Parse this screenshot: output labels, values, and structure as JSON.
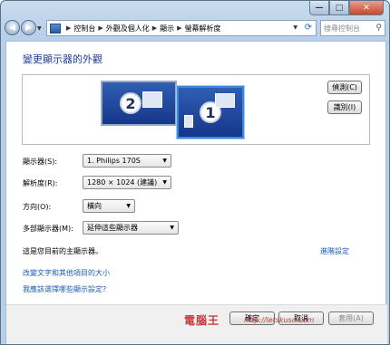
{
  "window": {
    "caption_min": "—",
    "caption_max": "□",
    "caption_close": "✕"
  },
  "nav": {
    "back_icon": "back-arrow-icon",
    "forward_icon": "forward-arrow-icon",
    "breadcrumbs": [
      "控制台",
      "外觀及個人化",
      "顯示",
      "螢幕解析度"
    ],
    "search_placeholder": "搜尋控制台"
  },
  "page": {
    "title": "變更顯示器的外觀",
    "detect_button": "偵測(C)",
    "identify_button": "識別(I)",
    "monitor_2_number": "2",
    "monitor_1_number": "1"
  },
  "settings": {
    "display_label": "顯示器(S):",
    "display_value": "1. Philips 170S",
    "resolution_label": "解析度(R):",
    "resolution_value": "1280 × 1024 (建議)",
    "orientation_label": "方向(O):",
    "orientation_value": "橫向",
    "multi_label": "多部顯示器(M):",
    "multi_value": "延伸這些顯示器"
  },
  "info": {
    "main_display_text": "這是您目前的主顯示器。",
    "advanced_link": "進階設定",
    "text_size_link": "改變文字和其他項目的大小",
    "which_settings_link": "我應該選擇哪些顯示設定?"
  },
  "footer": {
    "ok_button": "確定",
    "cancel_button": "取消",
    "apply_button": "套用(A)",
    "watermark": "電腦王",
    "watermark_url": "http://letskuso.com"
  }
}
